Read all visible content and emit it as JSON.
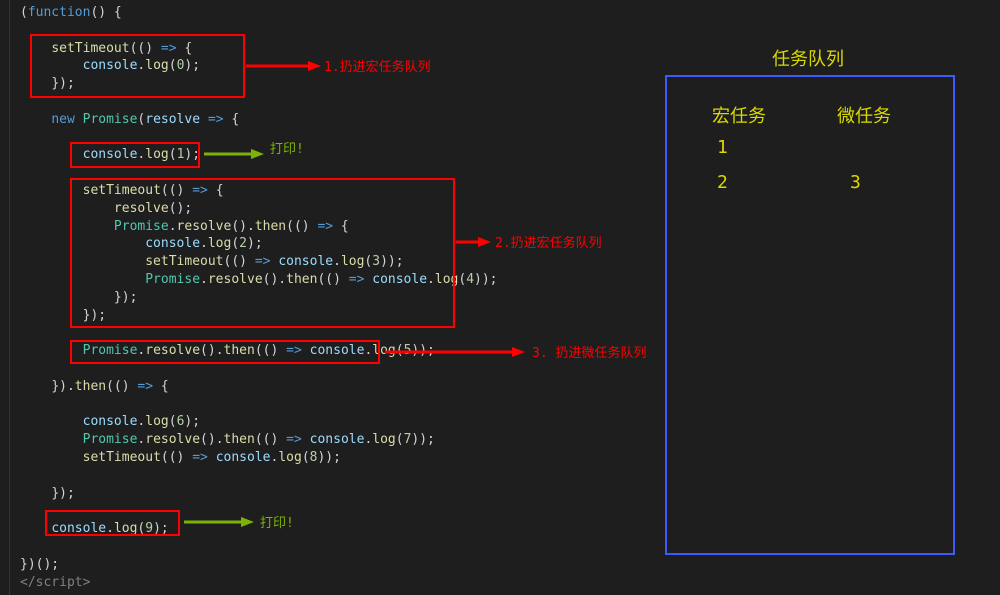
{
  "code": {
    "l0": "(function() {",
    "l1": "",
    "kw_new": "new",
    "cls_promise": "Promise",
    "fn_setTimeout": "setTimeout",
    "fn_resolve": "resolve",
    "fn_then": "then",
    "mem_console": "console",
    "mem_log": "log",
    "arrow_op": " => ",
    "l_close_paren_semi": "});",
    "l_close_brace_paren_colon": "})();",
    "tag_close": "</script>"
  },
  "numbers": {
    "n0": "0",
    "n1": "1",
    "n2": "2",
    "n3": "3",
    "n4": "4",
    "n5": "5",
    "n6": "6",
    "n7": "7",
    "n8": "8",
    "n9": "9"
  },
  "annotations": {
    "a1": "1.扔进宏任务队列",
    "a2": "打印!",
    "a3": "2.扔进宏任务队列",
    "a4": "3. 扔进微任务队列",
    "a5": "打印!"
  },
  "queue": {
    "title": "任务队列",
    "macro_label": "宏任务",
    "micro_label": "微任务",
    "macro": [
      "1",
      "2"
    ],
    "micro": [
      "3"
    ]
  }
}
